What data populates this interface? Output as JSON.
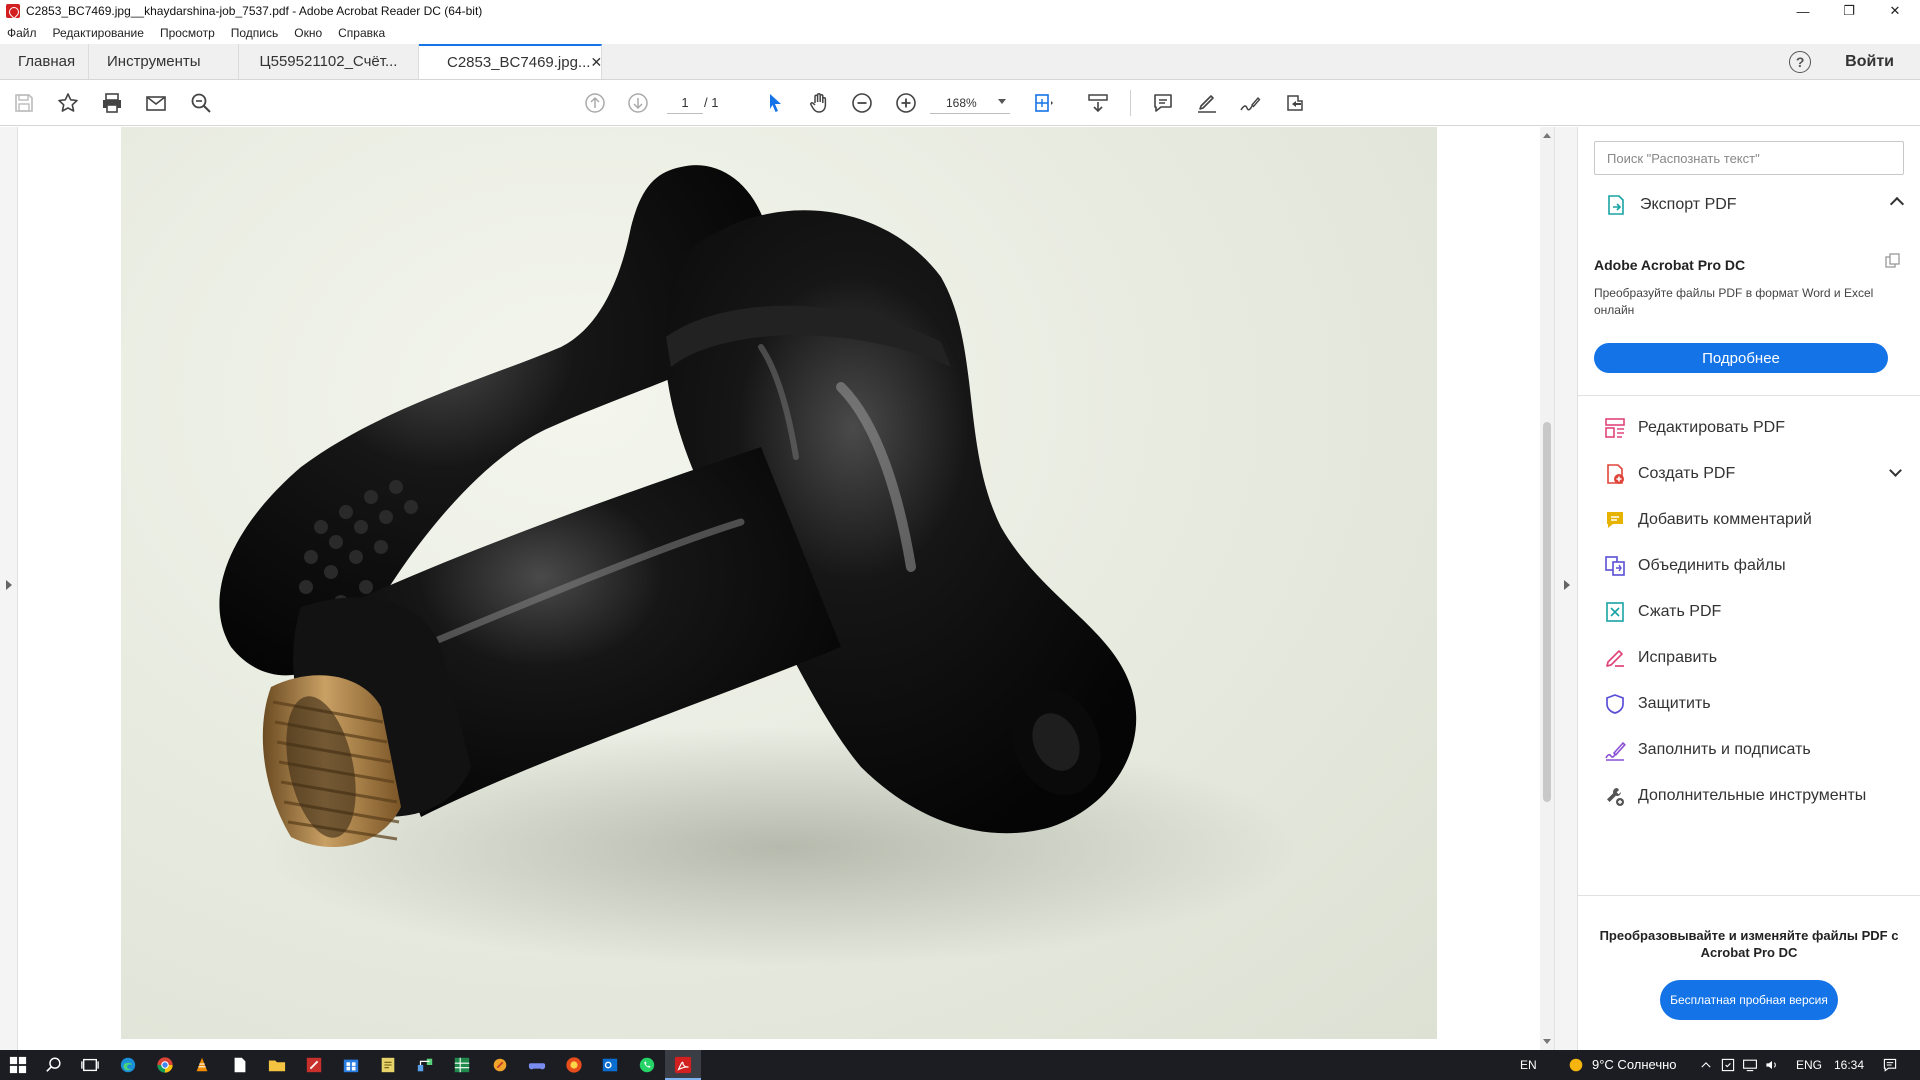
{
  "window": {
    "title": "C2853_BC7469.jpg__khaydarshina-job_7537.pdf - Adobe Acrobat Reader DC (64-bit)",
    "minimize": "—",
    "maximize": "❐",
    "close": "✕"
  },
  "menu": [
    "Файл",
    "Редактирование",
    "Просмотр",
    "Подпись",
    "Окно",
    "Справка"
  ],
  "tabs": {
    "home": "Главная",
    "tools": "Инструменты",
    "doc1": "Ц559521102_Счёт...",
    "doc2": "C2853_BC7469.jpg...",
    "close": "✕",
    "help": "?",
    "login": "Войти"
  },
  "toolbar": {
    "page_current": "1",
    "page_total": "/ 1",
    "zoom": "168%"
  },
  "panel": {
    "search_placeholder": "Поиск \"Распознать текст\"",
    "export_label": "Экспорт PDF",
    "promo_title": "Adobe Acrobat Pro DC",
    "promo_desc": "Преобразуйте файлы PDF в формат Word и Excel онлайн",
    "more_button": "Подробнее",
    "tools": [
      {
        "label": "Редактировать PDF",
        "icon": "edit-pdf-icon",
        "color": "#e0457b"
      },
      {
        "label": "Создать PDF",
        "icon": "create-pdf-icon",
        "color": "#e0453a"
      },
      {
        "label": "Добавить комментарий",
        "icon": "comment-icon",
        "color": "#e6b400"
      },
      {
        "label": "Объединить файлы",
        "icon": "combine-files-icon",
        "color": "#5b4fd6"
      },
      {
        "label": "Сжать PDF",
        "icon": "compress-pdf-icon",
        "color": "#1aa3a3"
      },
      {
        "label": "Исправить",
        "icon": "redact-icon",
        "color": "#e0457b"
      },
      {
        "label": "Защитить",
        "icon": "protect-icon",
        "color": "#5b4fd6"
      },
      {
        "label": "Заполнить и подписать",
        "icon": "fill-sign-icon",
        "color": "#8a4fd6"
      },
      {
        "label": "Дополнительные инструменты",
        "icon": "more-tools-icon",
        "color": "#555555"
      }
    ],
    "bottom_text": "Преобразовывайте и изменяйте файлы PDF с Acrobat Pro DC",
    "trial_button": "Бесплатная пробная версия"
  },
  "taskbar": {
    "lang": "EN",
    "weather": "9°C Солнечно",
    "lang2": "ENG",
    "time": "16:34"
  },
  "colors": {
    "accent": "#1473e6"
  }
}
